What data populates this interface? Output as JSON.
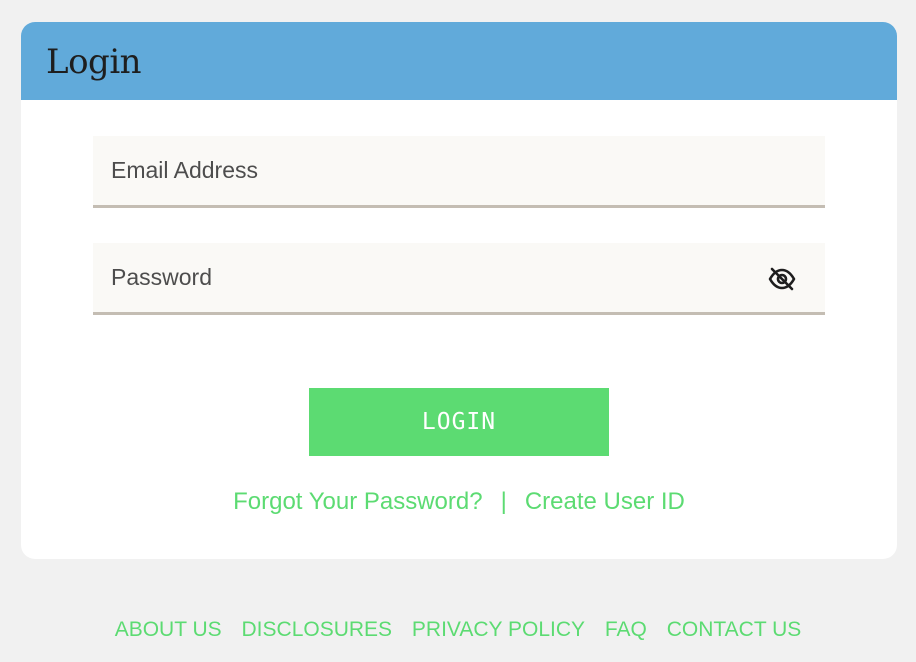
{
  "header": {
    "title": "Login"
  },
  "form": {
    "email": {
      "placeholder": "Email Address",
      "value": ""
    },
    "password": {
      "placeholder": "Password",
      "value": ""
    },
    "toggle_icon": "eye-slash-icon",
    "login_label": "LOGIN"
  },
  "links": {
    "forgot_password": "Forgot Your Password?",
    "separator": "|",
    "create_user_id": "Create User ID"
  },
  "footer": {
    "items": [
      {
        "label": "ABOUT US"
      },
      {
        "label": "DISCLOSURES"
      },
      {
        "label": "PRIVACY POLICY"
      },
      {
        "label": "FAQ"
      },
      {
        "label": "CONTACT US"
      }
    ]
  },
  "colors": {
    "header_bg": "#61aada",
    "accent_green": "#5cdb72",
    "page_bg": "#f1f1f1",
    "field_bg": "#faf9f6",
    "field_border": "#c4bdb3"
  }
}
